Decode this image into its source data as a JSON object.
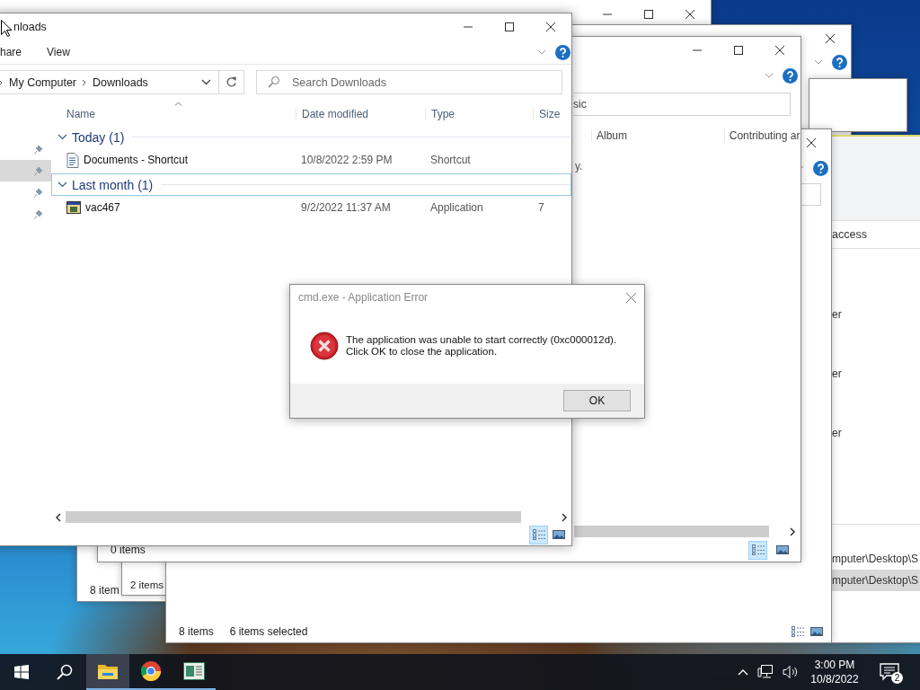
{
  "back_windows": [
    {
      "status": "8 item"
    },
    {
      "status": "2 items"
    }
  ],
  "quick_access_window": {
    "nav_item": "access",
    "items": [
      "er",
      "er",
      "er"
    ],
    "paths": [
      {
        "text": "mputer\\Desktop\\S",
        "selected": false
      },
      {
        "text": "mputer\\Desktop\\S",
        "selected": true
      }
    ]
  },
  "selection_window": {
    "item_count": "8 items",
    "selected_count": "6 items selected",
    "views": [
      {
        "selected": false
      },
      {
        "selected": false
      }
    ]
  },
  "music_window": {
    "search_value": "sic",
    "columns": [
      "Album",
      "Contributing ar"
    ],
    "cell": "y.",
    "status": "0 items",
    "views": [
      {
        "selected": true
      },
      {
        "selected": false
      }
    ]
  },
  "explorer": {
    "title": "nloads",
    "ribbon_tabs": [
      "hare",
      "View"
    ],
    "breadcrumb": [
      "My Computer",
      "Downloads"
    ],
    "search": {
      "placeholder": "Search Downloads"
    },
    "nav_rows": [
      {
        "selected": false
      },
      {
        "selected": true
      },
      {
        "selected": false
      },
      {
        "selected": false
      }
    ],
    "columns": [
      "Name",
      "Date modified",
      "Type",
      "Size"
    ],
    "groups": [
      {
        "label": "Today (1)",
        "expanded": true,
        "focused": false,
        "files": [
          {
            "kind": "shortcut",
            "name": "Documents - Shortcut",
            "date": "10/8/2022 2:59 PM",
            "type": "Shortcut"
          }
        ]
      },
      {
        "label": "Last month (1)",
        "expanded": true,
        "focused": true,
        "files": [
          {
            "kind": "application",
            "name": "vac467",
            "date": "9/2/2022 11:37 AM",
            "type": "Application",
            "size": "7"
          }
        ]
      }
    ],
    "views": [
      {
        "selected": true
      },
      {
        "selected": false
      }
    ]
  },
  "dialog": {
    "title": "cmd.exe - Application Error",
    "message": [
      "The application was unable to start correctly (0xc000012d).",
      "Click OK to close the application."
    ],
    "button": "OK"
  },
  "taskbar": {
    "apps": [
      {
        "kind": "explorer",
        "active": true
      },
      {
        "kind": "chrome",
        "active": false
      },
      {
        "kind": "app",
        "active": false
      }
    ],
    "time": "3:00 PM",
    "date": "10/8/2022",
    "notifications": "2"
  }
}
